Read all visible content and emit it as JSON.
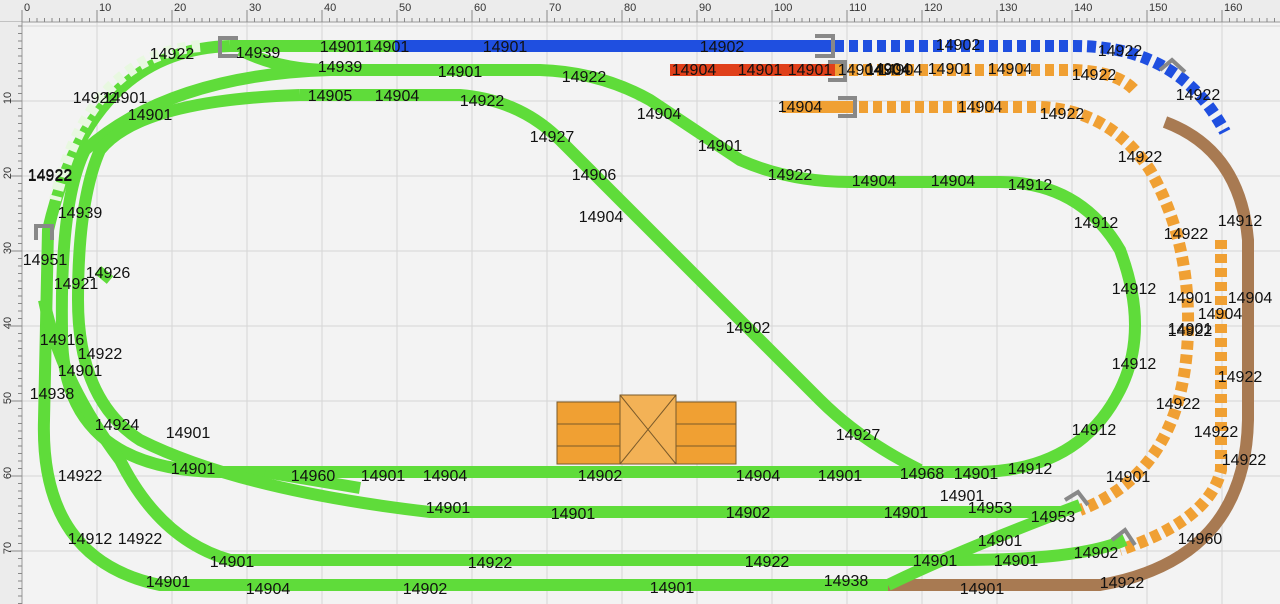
{
  "colors": {
    "green": "#5fdc3a",
    "green_dark": "#2a7d1a",
    "blue": "#1f4fe0",
    "orange": "#f0a033",
    "brown": "#a87a52",
    "red": "#e0401a",
    "grid": "#d6d6d6",
    "background": "#f3f3f3"
  },
  "ruler": {
    "top": [
      "0",
      "10",
      "20",
      "30",
      "40",
      "50",
      "60",
      "70",
      "80",
      "90",
      "100",
      "110",
      "120",
      "130",
      "140",
      "150",
      "160"
    ],
    "left": [
      "10",
      "20",
      "30",
      "40",
      "50",
      "60",
      "70"
    ]
  },
  "labels": [
    "14922",
    "14939",
    "14901",
    "14901",
    "14901",
    "14902",
    "14902",
    "14922",
    "14922",
    "14939",
    "14901",
    "14922",
    "14904",
    "14904",
    "14901",
    "14901",
    "14904",
    "14904",
    "14901",
    "14904",
    "14922",
    "14922",
    "14901",
    "14905",
    "14904",
    "14922",
    "14904",
    "14904",
    "14904",
    "14922",
    "14901",
    "14927",
    "14904",
    "14922",
    "14906",
    "14901",
    "14922",
    "14904",
    "14904",
    "14912",
    "14922",
    "14939",
    "14904",
    "14912",
    "14922",
    "14912",
    "14926",
    "14921",
    "14951",
    "14901",
    "14904",
    "14916",
    "14922",
    "14901",
    "14901",
    "14938",
    "14912",
    "14902",
    "14904",
    "14924",
    "14901",
    "14927",
    "14922",
    "14912",
    "14922",
    "14901",
    "14960",
    "14901",
    "14904",
    "14902",
    "14904",
    "14901",
    "14968",
    "14901",
    "14912",
    "14912",
    "14922",
    "14922",
    "14901",
    "14901",
    "14953",
    "14901",
    "14901",
    "14902",
    "14901",
    "14953",
    "14912",
    "14922",
    "14901",
    "14922",
    "14922",
    "14901",
    "14901",
    "14902",
    "14960",
    "14901",
    "14922",
    "14901",
    "14904",
    "14902",
    "14901",
    "14938",
    "14901",
    "14922",
    "14922",
    "14922"
  ],
  "building": {
    "color": "#f0a033"
  }
}
